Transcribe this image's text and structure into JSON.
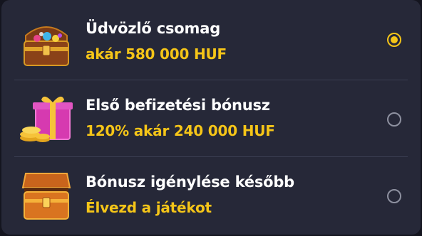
{
  "options": [
    {
      "title": "Üdvözlő csomag",
      "subtitle": "akár 580 000 HUF",
      "icon": "treasure-chest-gems-icon",
      "selected": true
    },
    {
      "title": "Első befizetési bónusz",
      "subtitle": "120% akár 240 000 HUF",
      "icon": "gift-box-coins-icon",
      "selected": false
    },
    {
      "title": "Bónusz igénylése később",
      "subtitle": "Élvezd a játékot",
      "icon": "treasure-chest-open-icon",
      "selected": false
    }
  ],
  "colors": {
    "panel": "#262838",
    "accent": "#f5c518",
    "radio_inactive": "#8e91a0",
    "title_text": "#ffffff"
  }
}
